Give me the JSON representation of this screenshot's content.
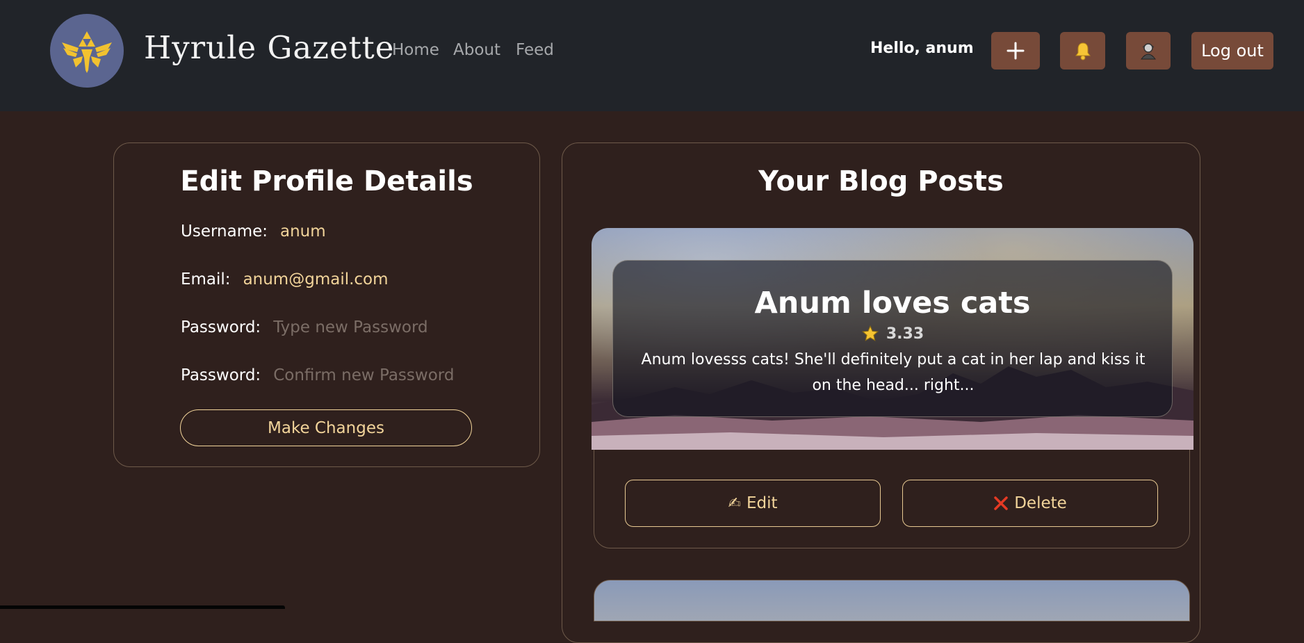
{
  "header": {
    "brand": "Hyrule Gazette",
    "nav": {
      "home": "Home",
      "about": "About",
      "feed": "Feed"
    },
    "greeting": "Hello, anum",
    "add_icon": "plus-icon",
    "bell_icon": "bell-icon",
    "user_icon": "user-icon",
    "logout_label": "Log out",
    "logo_icon": "triforce-crest-icon"
  },
  "profile": {
    "title": "Edit Profile Details",
    "username_label": "Username:",
    "username_value": "anum",
    "email_label": "Email:",
    "email_value": "anum@gmail.com",
    "password_label": "Password:",
    "password_placeholder": "Type new Password",
    "confirm_label": "Password:",
    "confirm_placeholder": "Confirm new Password",
    "submit_label": "Make Changes"
  },
  "blog": {
    "title": "Your Blog Posts",
    "posts": [
      {
        "title": "Anum loves cats",
        "rating": "3.33",
        "rating_icon": "star-icon",
        "excerpt": "Anum lovesss cats! She'll definitely put a cat in her lap and kiss it on the head... right...",
        "edit_label": "Edit",
        "edit_icon": "✍",
        "delete_label": "Delete",
        "delete_icon": "❌"
      }
    ]
  },
  "colors": {
    "navbar_bg": "#212429",
    "page_bg": "#2f201d",
    "accent_button": "#774a39",
    "accent_text": "#f2d49a",
    "logo_bg": "#5b6590"
  }
}
